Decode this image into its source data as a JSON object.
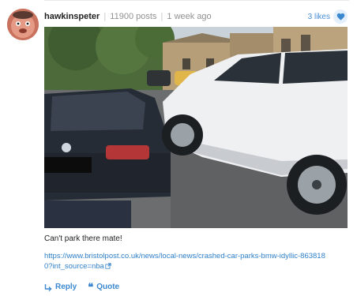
{
  "post": {
    "username": "hawkinspeter",
    "post_count": "11900 posts",
    "time_ago": "1 week ago",
    "separator": "|",
    "likes_label": "3 likes",
    "caption": "Can't park there mate!",
    "link_text": "https://www.bristolpost.co.uk/news/local-news/crashed-car-parks-bmw-idyllic-8638180?int_source=nba",
    "actions": {
      "reply_label": "Reply",
      "quote_label": "Quote"
    }
  },
  "icons": {
    "heart": "heart-icon",
    "reply": "reply-arrow-icon",
    "quote": "quote-icon",
    "external_link": "external-link-icon"
  },
  "colors": {
    "accent": "#3c88d0",
    "link": "#2f7fc8",
    "meta": "#919191"
  }
}
